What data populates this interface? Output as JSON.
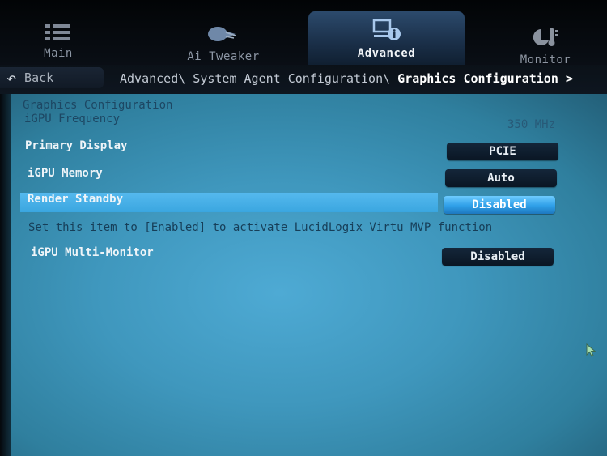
{
  "tabs": [
    {
      "label": "Main",
      "icon": "list-icon",
      "active": false
    },
    {
      "label": "Ai Tweaker",
      "icon": "turbo-fan-icon",
      "active": false
    },
    {
      "label": "Advanced",
      "icon": "monitor-info-icon",
      "active": true
    },
    {
      "label": "Monitor",
      "icon": "thermometer-icon",
      "active": false
    }
  ],
  "nav": {
    "back_label": "Back",
    "breadcrumb_path": "Advanced\\ System Agent Configuration\\ ",
    "breadcrumb_current": "Graphics Configuration",
    "breadcrumb_chevron": ">"
  },
  "content": {
    "section_title": "Graphics Configuration",
    "igpu_frequency": {
      "label": "iGPU Frequency",
      "value": "350 MHz"
    },
    "settings": [
      {
        "label": "Primary Display",
        "value": "PCIE",
        "selected": false
      },
      {
        "label": "iGPU Memory",
        "value": "Auto",
        "selected": false
      },
      {
        "label": "Render Standby",
        "value": "Disabled",
        "selected": true
      },
      {
        "label": "iGPU Multi-Monitor",
        "value": "Disabled",
        "selected": false
      }
    ],
    "help_text": "Set this item to [Enabled] to activate LucidLogix Virtu MVP function"
  },
  "colors": {
    "accent_highlight": "#3aa6e0",
    "panel_bg": "#3f97bd",
    "selector_bg": "#0a1624"
  }
}
